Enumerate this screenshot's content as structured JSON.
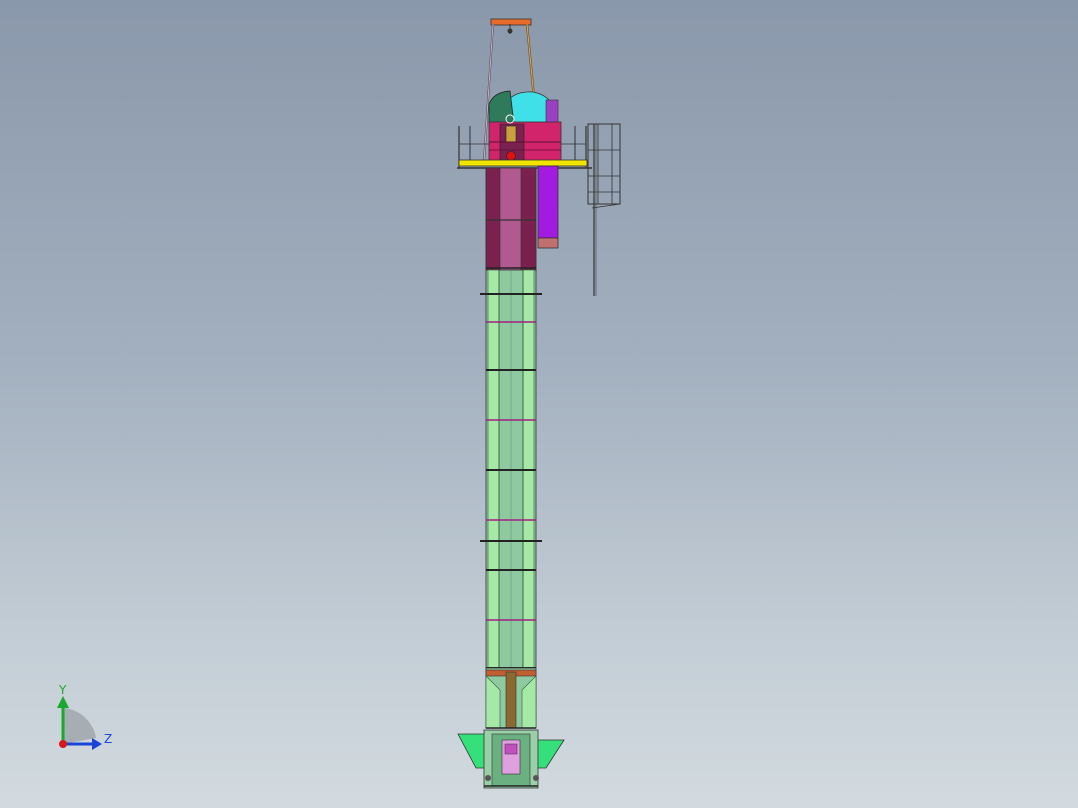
{
  "viewport": {
    "background_top": "#8a98ab",
    "background_bottom": "#d2dadf"
  },
  "model": {
    "description_icon": "bucket-elevator-3d-model",
    "colors": {
      "casing": "#a6e8a6",
      "frame": "#2f5f38",
      "head_pink": "#d1246a",
      "head_dark": "#7a2150",
      "cover_cyan": "#3fe0e8",
      "cover_teal": "#2f7a5a",
      "platform_yellow": "#f2e600",
      "chute_purple": "#a11ce0",
      "boot_green": "#35e07a",
      "top_beam_orange": "#e86b2c",
      "drive_red": "#e01010"
    }
  },
  "triad": {
    "y_label": "Y",
    "z_label": "Z",
    "y_color": "#1aa82e",
    "z_color": "#1844d8",
    "x_color": "#d81818"
  }
}
